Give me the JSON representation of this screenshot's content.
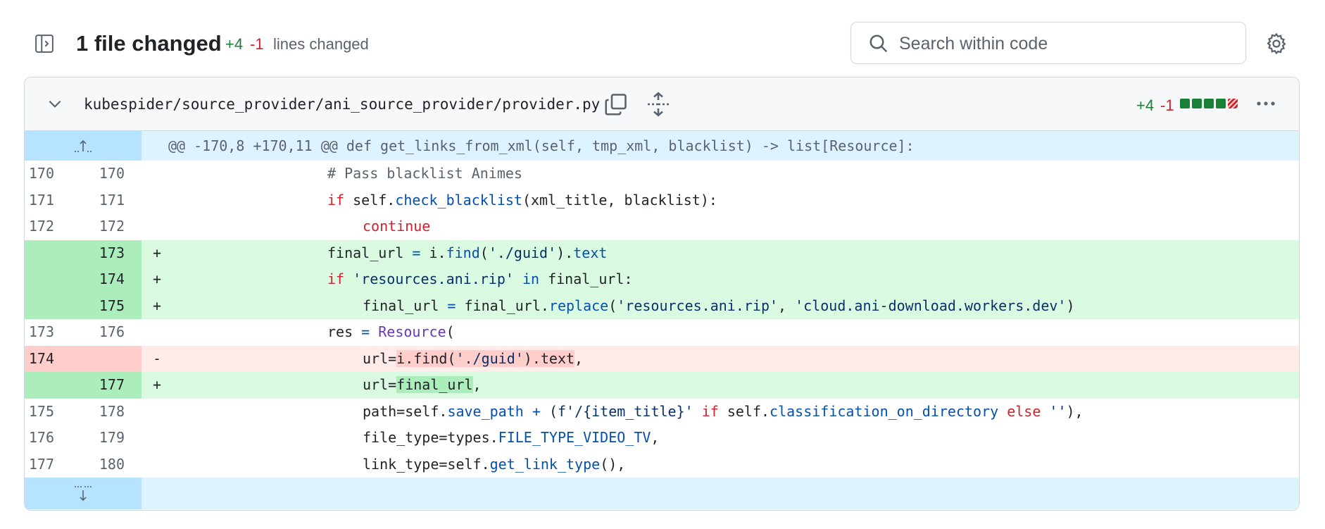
{
  "toolbar": {
    "files_changed": "1 file changed",
    "additions": "+4",
    "deletions": "-1",
    "lines_changed_label": "lines changed",
    "search_placeholder": "Search within code"
  },
  "file": {
    "path": "kubespider/source_provider/ani_source_provider/provider.py",
    "additions": "+4",
    "deletions": "-1",
    "diffstat": [
      "add",
      "add",
      "add",
      "add",
      "del"
    ]
  },
  "hunk": {
    "header": "@@ -170,8 +170,11 @@ def get_links_from_xml(self, tmp_xml, blacklist) -> list[Resource]:"
  },
  "lines": [
    {
      "type": "ctx",
      "old": "170",
      "new": "170",
      "mark": ""
    },
    {
      "type": "ctx",
      "old": "171",
      "new": "171",
      "mark": ""
    },
    {
      "type": "ctx",
      "old": "172",
      "new": "172",
      "mark": ""
    },
    {
      "type": "add",
      "old": "",
      "new": "173",
      "mark": "+"
    },
    {
      "type": "add",
      "old": "",
      "new": "174",
      "mark": "+"
    },
    {
      "type": "add",
      "old": "",
      "new": "175",
      "mark": "+"
    },
    {
      "type": "ctx",
      "old": "173",
      "new": "176",
      "mark": ""
    },
    {
      "type": "del",
      "old": "174",
      "new": "",
      "mark": "-"
    },
    {
      "type": "add",
      "old": "",
      "new": "177",
      "mark": "+"
    },
    {
      "type": "ctx",
      "old": "175",
      "new": "178",
      "mark": ""
    },
    {
      "type": "ctx",
      "old": "176",
      "new": "179",
      "mark": ""
    },
    {
      "type": "ctx",
      "old": "177",
      "new": "180",
      "mark": ""
    }
  ],
  "code": {
    "l0": [
      "# Pass blacklist Animes"
    ],
    "l1": [
      "if",
      " self.",
      "check_blacklist",
      "(xml_title, blacklist):"
    ],
    "l2": [
      "continue"
    ],
    "l3": [
      "final_url ",
      "=",
      " i.",
      "find",
      "(",
      "'./guid'",
      ").",
      "text"
    ],
    "l4": [
      "if",
      " ",
      "'resources.ani.rip'",
      " ",
      "in",
      " final_url:"
    ],
    "l5": [
      "final_url ",
      "=",
      " final_url.",
      "replace",
      "(",
      "'resources.ani.rip'",
      ", ",
      "'cloud.ani-download.workers.dev'",
      ")"
    ],
    "l6": [
      "res ",
      "=",
      " ",
      "Resource",
      "("
    ],
    "l7": [
      "url",
      "=",
      "i.find(",
      "'./guid'",
      ").text",
      ","
    ],
    "l8": [
      "url",
      "=",
      "final_url",
      ","
    ],
    "l9": [
      "path",
      "=",
      "self.",
      "save_path",
      " ",
      "+",
      " (",
      "f'/{item_title}'",
      " ",
      "if",
      " self.",
      "classification_on_directory",
      " ",
      "else",
      " ",
      "''",
      "),"
    ],
    "l10": [
      "file_type",
      "=",
      "types.",
      "FILE_TYPE_VIDEO_TV",
      ","
    ],
    "l11": [
      "link_type",
      "=",
      "self.",
      "get_link_type",
      "(),"
    ]
  }
}
